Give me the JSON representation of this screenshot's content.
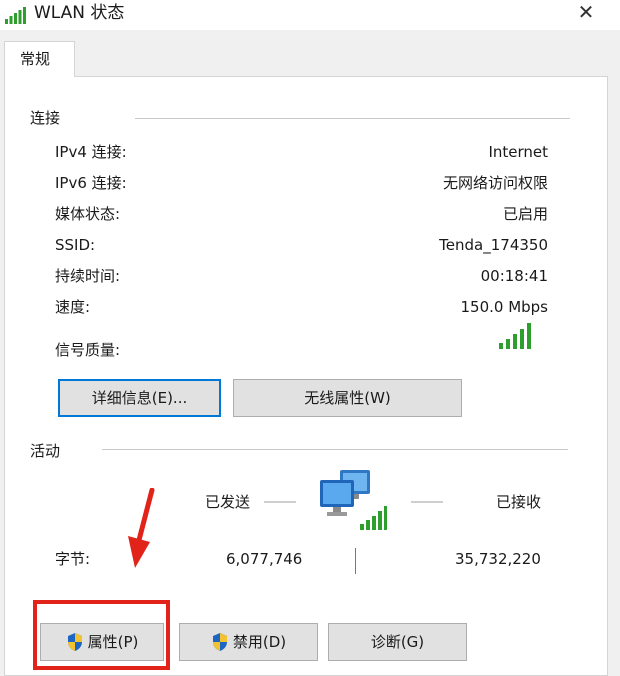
{
  "window": {
    "title": "WLAN 状态",
    "title_icon": "wifi-signal-icon",
    "close_glyph": "✕"
  },
  "tabs": [
    {
      "label": "常规",
      "selected": true
    }
  ],
  "connection": {
    "section_title": "连接",
    "rows": [
      {
        "label": "IPv4 连接:",
        "value": "Internet"
      },
      {
        "label": "IPv6 连接:",
        "value": "无网络访问权限"
      },
      {
        "label": "媒体状态:",
        "value": "已启用"
      },
      {
        "label": "SSID:",
        "value": "Tenda_174350"
      },
      {
        "label": "持续时间:",
        "value": "00:18:41"
      },
      {
        "label": "速度:",
        "value": "150.0 Mbps"
      }
    ],
    "signal_label": "信号质量:",
    "signal_bars": 5,
    "buttons": {
      "details": "详细信息(E)...",
      "wireless_properties": "无线属性(W)"
    }
  },
  "activity": {
    "section_title": "活动",
    "sent_label": "已发送",
    "received_label": "已接收",
    "bytes_label": "字节:",
    "bytes_sent": "6,077,746",
    "bytes_received": "35,732,220"
  },
  "bottom_buttons": {
    "properties": "属性(P)",
    "disable": "禁用(D)",
    "diagnose": "诊断(G)"
  },
  "colors": {
    "accent": "#0078d7",
    "signal_green": "#2e9e2e",
    "annotation_red": "#e2231a"
  }
}
